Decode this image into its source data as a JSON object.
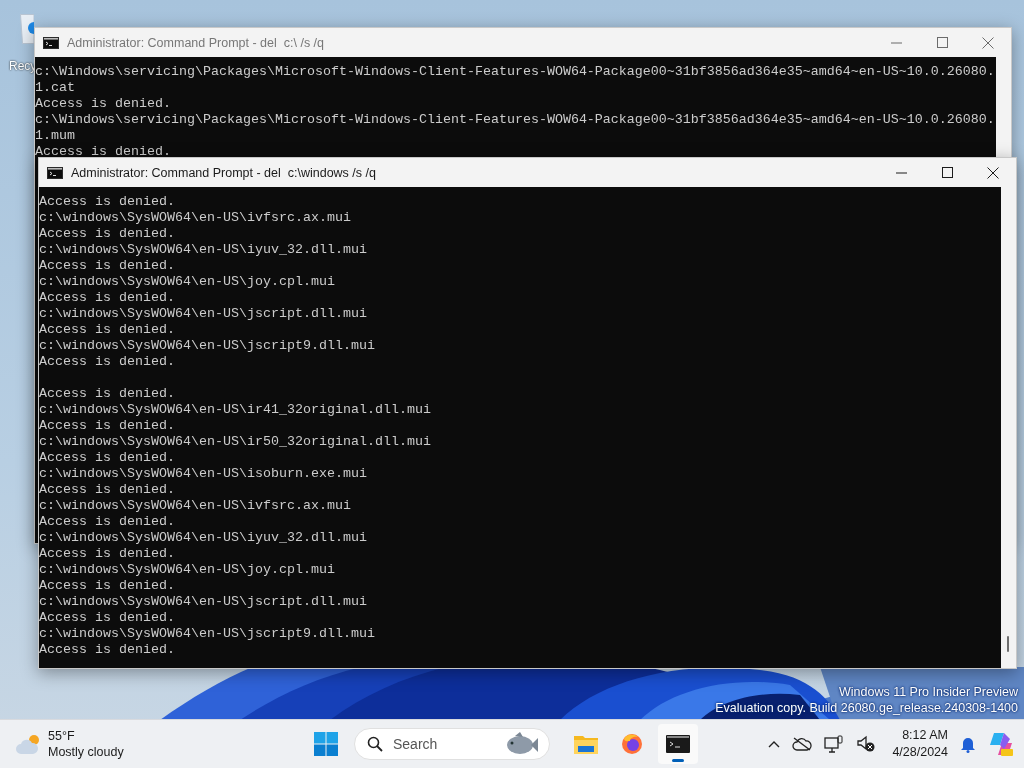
{
  "desktop": {
    "recycle_bin_label": "Recy",
    "edition": "Windows 11 Pro Insider Preview",
    "build": "Evaluation copy. Build 26080.ge_release.240308-1400"
  },
  "windows": [
    {
      "title": "Administrator: Command Prompt - del  c:\\ /s /q",
      "active": false,
      "lines": [
        {
          "kind": "text",
          "text": "c:\\Windows\\servicing\\Packages\\Microsoft-Windows-Client-Features-WOW64-Package00~31bf3856ad364e35~amd64~en-US~10.0.26080."
        },
        {
          "kind": "text",
          "text": "1.cat"
        },
        {
          "kind": "text",
          "text": "Access is denied."
        },
        {
          "kind": "text",
          "text": "c:\\Windows\\servicing\\Packages\\Microsoft-Windows-Client-Features-WOW64-Package00~31bf3856ad364e35~amd64~en-US~10.0.26080."
        },
        {
          "kind": "text",
          "text": "1.mum"
        },
        {
          "kind": "text",
          "text": "Access is denied."
        }
      ]
    },
    {
      "title": "Administrator: Command Prompt - del  c:\\windows /s /q",
      "active": true,
      "lines": [
        {
          "kind": "text",
          "text": "Access is denied."
        },
        {
          "kind": "text",
          "text": "c:\\windows\\SysWOW64\\en-US\\ivfsrc.ax.mui"
        },
        {
          "kind": "text",
          "text": "Access is denied."
        },
        {
          "kind": "text",
          "text": "c:\\windows\\SysWOW64\\en-US\\iyuv_32.dll.mui"
        },
        {
          "kind": "text",
          "text": "Access is denied."
        },
        {
          "kind": "text",
          "text": "c:\\windows\\SysWOW64\\en-US\\joy.cpl.mui"
        },
        {
          "kind": "text",
          "text": "Access is denied."
        },
        {
          "kind": "text",
          "text": "c:\\windows\\SysWOW64\\en-US\\jscript.dll.mui"
        },
        {
          "kind": "text",
          "text": "Access is denied."
        },
        {
          "kind": "text",
          "text": "c:\\windows\\SysWOW64\\en-US\\jscript9.dll.mui"
        },
        {
          "kind": "text",
          "text": "Access is denied."
        },
        {
          "kind": "blank"
        },
        {
          "kind": "text",
          "text": "Access is denied."
        },
        {
          "kind": "text",
          "text": "c:\\windows\\SysWOW64\\en-US\\ir41_32original.dll.mui"
        },
        {
          "kind": "text",
          "text": "Access is denied."
        },
        {
          "kind": "text",
          "text": "c:\\windows\\SysWOW64\\en-US\\ir50_32original.dll.mui"
        },
        {
          "kind": "text",
          "text": "Access is denied."
        },
        {
          "kind": "text",
          "text": "c:\\windows\\SysWOW64\\en-US\\isoburn.exe.mui"
        },
        {
          "kind": "text",
          "text": "Access is denied."
        },
        {
          "kind": "text",
          "text": "c:\\windows\\SysWOW64\\en-US\\ivfsrc.ax.mui"
        },
        {
          "kind": "text",
          "text": "Access is denied."
        },
        {
          "kind": "text",
          "text": "c:\\windows\\SysWOW64\\en-US\\iyuv_32.dll.mui"
        },
        {
          "kind": "text",
          "text": "Access is denied."
        },
        {
          "kind": "text",
          "text": "c:\\windows\\SysWOW64\\en-US\\joy.cpl.mui"
        },
        {
          "kind": "text",
          "text": "Access is denied."
        },
        {
          "kind": "text",
          "text": "c:\\windows\\SysWOW64\\en-US\\jscript.dll.mui"
        },
        {
          "kind": "text",
          "text": "Access is denied."
        },
        {
          "kind": "text",
          "text": "c:\\windows\\SysWOW64\\en-US\\jscript9.dll.mui"
        },
        {
          "kind": "text",
          "text": "Access is denied."
        }
      ]
    }
  ],
  "taskbar": {
    "weather": {
      "temperature": "55°F",
      "condition": "Mostly cloudy"
    },
    "search": {
      "placeholder": "Search"
    },
    "apps": [
      {
        "kind": "explorer",
        "selected": false
      },
      {
        "kind": "firefox",
        "selected": false
      },
      {
        "kind": "terminal",
        "selected": true
      }
    ],
    "clock": {
      "time": "8:12 AM",
      "date": "4/28/2024"
    }
  }
}
